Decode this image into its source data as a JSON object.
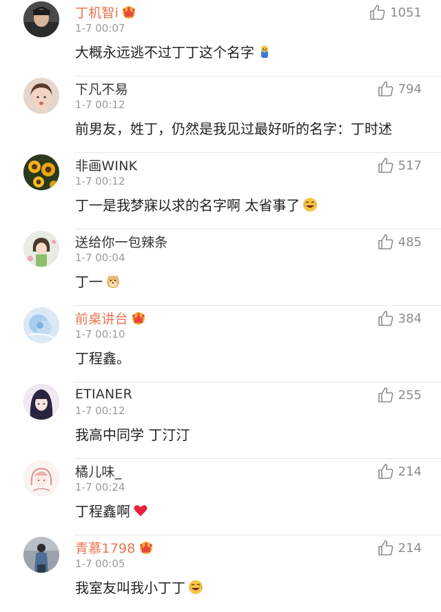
{
  "comments": [
    {
      "username": "丁机智i",
      "vip": true,
      "time": "1-7 00:07",
      "likes": "1051",
      "text": "大概永远逃不过丁丁这个名字",
      "emoji": "crying-figure-emoji",
      "avatar": "avatar-young-man"
    },
    {
      "username": "下凡不易",
      "vip": false,
      "time": "1-7 00:12",
      "likes": "794",
      "text": "前男友，姓丁，仍然是我见过最好听的名字：丁时述",
      "emoji": "",
      "avatar": "avatar-girl"
    },
    {
      "username": "非画WINK",
      "vip": false,
      "time": "1-7 00:12",
      "likes": "517",
      "text": "丁一是我梦寐以求的名字啊  太省事了",
      "emoji": "laughing-tears-emoji",
      "avatar": "avatar-sunflowers"
    },
    {
      "username": "送给你一包辣条",
      "vip": false,
      "time": "1-7 00:04",
      "likes": "485",
      "text": "丁一",
      "emoji": "doge-emoji",
      "avatar": "avatar-anime-girl"
    },
    {
      "username": "前桌讲台",
      "vip": true,
      "time": "1-7 00:10",
      "likes": "384",
      "text": "丁程鑫。",
      "emoji": "",
      "avatar": "avatar-blue-flower"
    },
    {
      "username": "ETIANER",
      "vip": false,
      "time": "1-7 00:12",
      "likes": "255",
      "text": "我高中同学 丁汀汀",
      "emoji": "",
      "avatar": "avatar-dark-hair-girl"
    },
    {
      "username": "橘儿味_",
      "vip": false,
      "time": "1-7 00:24",
      "likes": "214",
      "text": "丁程鑫啊",
      "emoji": "red-heart-emoji",
      "avatar": "avatar-sketch-girl"
    },
    {
      "username": "青慕1798",
      "vip": true,
      "time": "1-7 00:05",
      "likes": "214",
      "text": "我室友叫我小丁丁",
      "emoji": "laughing-tears-emoji",
      "avatar": "avatar-man-blue-sweater"
    }
  ],
  "colors": {
    "vip_name": "#eb7350",
    "normal_name": "#333333",
    "time": "#9a9a9a",
    "like": "#8c8c8c",
    "divider": "#e6e6e6"
  }
}
